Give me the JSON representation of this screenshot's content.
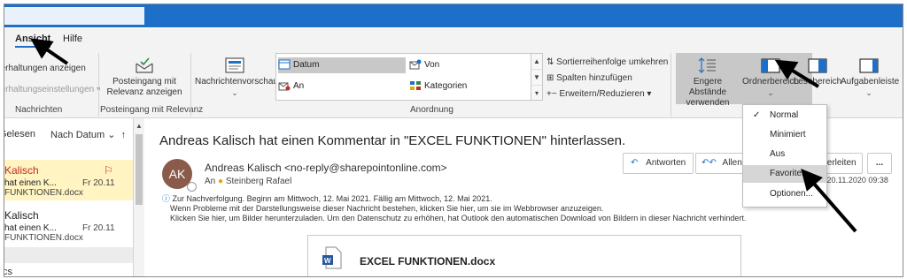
{
  "tabs": [
    {
      "label": "Ansicht",
      "active": true
    },
    {
      "label": "Hilfe",
      "active": false
    }
  ],
  "ribbon": {
    "nachrichten": {
      "items": [
        "Unterhaltungen anzeigen",
        "Unterhaltungseinstellungen ▾"
      ],
      "group_label": "Nachrichten"
    },
    "posteingang": {
      "button": "Posteingang mit Relevanz anzeigen",
      "group_label": "Posteingang mit Relevanz"
    },
    "vorschau": {
      "button": "Nachrichtenvorschau"
    },
    "anordnung": {
      "gallery": [
        "Datum",
        "Von",
        "An",
        "Kategorien"
      ],
      "selected": "Datum",
      "options": [
        "Sortierreihenfolge umkehren",
        "Spalten hinzufügen",
        "Erweitern/Reduzieren ▾"
      ],
      "group_label": "Anordnung"
    },
    "layout": {
      "buttons": [
        "Engere Abstände verwenden",
        "Ordnerbereich",
        "Lesebereich",
        "Aufgabenleiste"
      ]
    }
  },
  "folder": {
    "header": "Gelesen",
    "sort": "Nach Datum",
    "messages": [
      {
        "sender": "Kalisch",
        "subject": "hat einen K...",
        "attachment": "FUNKTIONEN.docx",
        "date": "Fr 20.11",
        "flagged": true,
        "selected": true
      },
      {
        "sender": "Kalisch",
        "subject": "hat einen K...",
        "attachment": "FUNKTIONEN.docx",
        "date": "Fr 20.11",
        "flagged": false,
        "selected": false
      }
    ],
    "footer": "cs"
  },
  "email": {
    "subject": "Andreas Kalisch hat einen Kommentar in \"EXCEL FUNKTIONEN\" hinterlassen.",
    "avatar": "AK",
    "from": "Andreas Kalisch <no-reply@sharepointonline.com>",
    "to_label": "An",
    "to": "Steinberg Rafael",
    "info_lines": [
      "Zur Nachverfolgung.  Beginn am Mittwoch, 12. Mai 2021.  Fällig am Mittwoch, 12. Mai 2021.",
      "Wenn Probleme mit der Darstellungsweise dieser Nachricht bestehen, klicken Sie hier, um sie im Webbrowser anzuzeigen.",
      "Klicken Sie hier, um Bilder herunterzuladen. Um den Datenschutz zu erhöhen, hat Outlook den automatischen Download von Bildern in dieser Nachricht verhindert."
    ],
    "actions": [
      "Antworten",
      "Allen a",
      "terleiten",
      "..."
    ],
    "datetime": "r 20.11.2020 09:38",
    "attachment_name": "EXCEL FUNKTIONEN.docx"
  },
  "dropdown": {
    "items": [
      {
        "label": "Normal",
        "checked": true,
        "hover": false
      },
      {
        "label": "Minimiert",
        "checked": false,
        "hover": false
      },
      {
        "label": "Aus",
        "checked": false,
        "hover": false
      },
      {
        "label": "Favoriten",
        "checked": false,
        "hover": true
      },
      {
        "label": "Optionen...",
        "checked": false,
        "hover": false
      }
    ]
  },
  "colors": {
    "titlebar": "#1e6fc7",
    "accent": "#1e6fc7",
    "flag": "#c42b1c",
    "selected_row": "#fff4c2"
  }
}
